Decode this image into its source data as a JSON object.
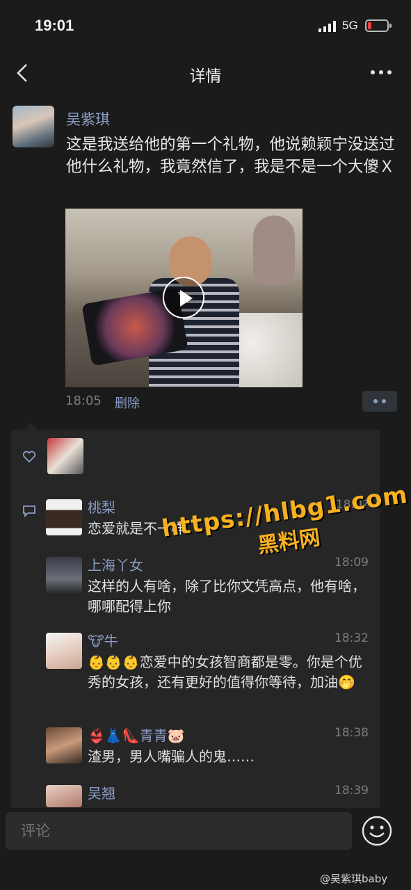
{
  "status_bar": {
    "time": "19:01",
    "network": "5G"
  },
  "nav": {
    "title": "详情"
  },
  "post": {
    "author": "吴紫琪",
    "text": "这是我送给他的第一个礼物，他说赖颖宁没送过他什么礼物，我竟然信了，我是不是一个大傻Ｘ",
    "time": "18:05",
    "delete_label": "删除"
  },
  "comments": [
    {
      "name": "桃梨",
      "time": "18:0?",
      "text": "恋爱就是不一样"
    },
    {
      "name": "上海丫女",
      "time": "18:09",
      "text": "这样的人有啥，除了比你文凭高点，他有啥，哪哪配得上你"
    },
    {
      "name": "🐮牛",
      "time": "18:32",
      "text": "👶👶👶恋爱中的女孩智商都是零。你是个优秀的女孩，还有更好的值得你等待，加油🤭"
    },
    {
      "name": "👙👗👠青青🐷",
      "time": "18:38",
      "text": "渣男，男人嘴骗人的鬼……"
    },
    {
      "name": "吴翘",
      "time": "18:39",
      "text": ""
    }
  ],
  "watermark": {
    "url": "https://hlbg1.com",
    "name": "黑料网"
  },
  "input": {
    "placeholder": "评论"
  },
  "footer": {
    "credit": "@吴紫琪baby"
  },
  "colors": {
    "accent": "#8c9dc5",
    "background": "#1b1b1b",
    "watermark": "#f7b11f"
  },
  "icons": {
    "back": "chevron-left-icon",
    "more": "more-dots-icon",
    "play": "play-icon",
    "heart": "heart-icon",
    "comment": "comment-icon",
    "emoji": "emoji-icon"
  }
}
